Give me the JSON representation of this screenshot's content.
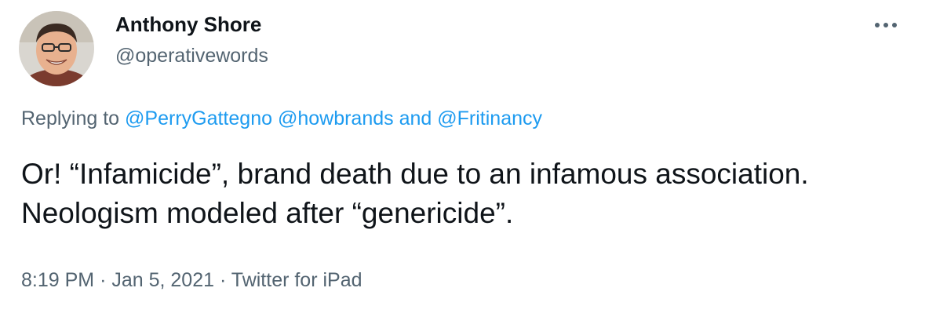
{
  "author": {
    "name": "Anthony Shore",
    "handle": "@operativewords",
    "avatar_icon": "user-avatar-photo"
  },
  "more_icon": "more-horizontal-icon",
  "reply": {
    "prefix": "Replying to",
    "mentions": [
      "@PerryGattegno",
      "@howbrands",
      "@Fritinancy"
    ],
    "conjunction": "and"
  },
  "tweet": {
    "text": "Or! “Infamicide”, brand death due to an infamous association. Neologism modeled after “genericide”."
  },
  "meta": {
    "time": "8:19 PM",
    "separator": "·",
    "date": "Jan 5, 2021",
    "source": "Twitter for iPad"
  },
  "colors": {
    "link": "#1d9bf0",
    "secondary_text": "#536471",
    "primary_text": "#0f1419",
    "background": "#ffffff"
  }
}
